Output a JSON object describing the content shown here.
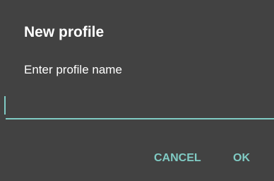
{
  "dialog": {
    "title": "New profile",
    "message": "Enter profile name",
    "input": {
      "value": "",
      "placeholder": ""
    },
    "buttons": {
      "cancel_label": "CANCEL",
      "ok_label": "OK"
    }
  },
  "colors": {
    "background": "#424242",
    "accent": "#80cbc4",
    "text": "#ffffff"
  }
}
